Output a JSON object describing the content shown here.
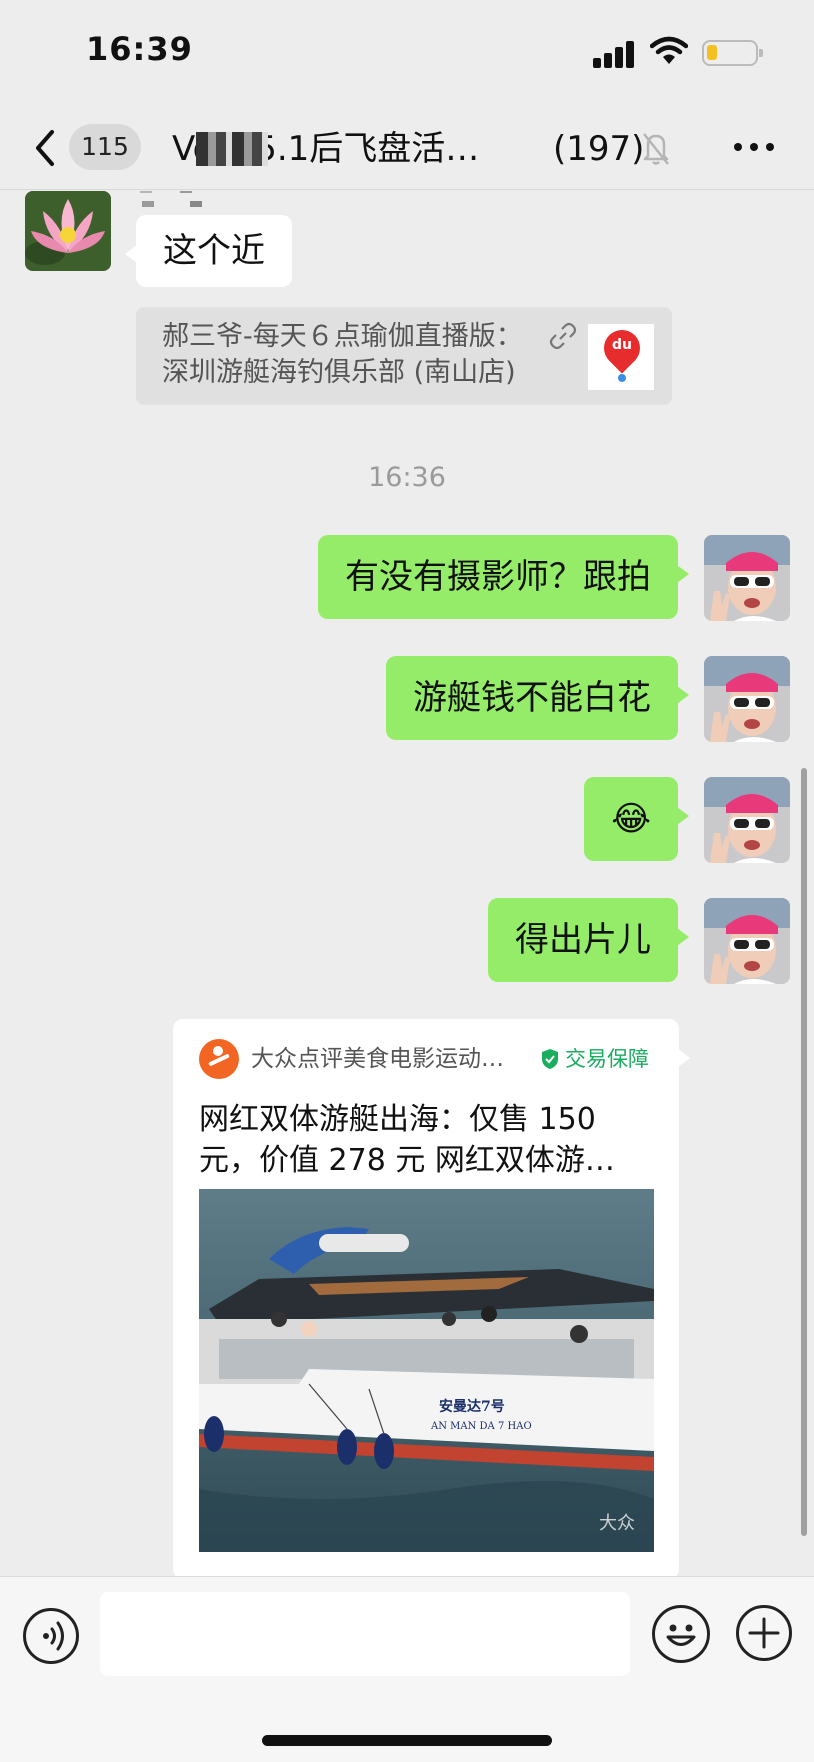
{
  "status_bar": {
    "time": "16:39"
  },
  "nav": {
    "unread_count": "115",
    "title": "Volu  5.1后飞盘活…",
    "member_count": "(197)"
  },
  "messages": {
    "received_text": "这个近",
    "quote_line1": "郝三爷-每天６点瑜伽直播版：",
    "quote_line2": "深圳游艇海钓俱乐部 (南山店)",
    "quote_thumb_label": "du",
    "timestamp": "16:36",
    "sent": [
      {
        "text": "有没有摄影师？跟拍"
      },
      {
        "text": "游艇钱不能白花"
      },
      {
        "text": "😂"
      },
      {
        "text": "得出片儿"
      }
    ]
  },
  "card": {
    "source": "大众点评美食电影运动…",
    "guarantee": "交易保障",
    "title": "网红双体游艇出海：仅售 150 元，价值 278 元 网红双体游…",
    "boat_name": "安曼达7号",
    "boat_name_en": "AN MAN DA 7 HAO",
    "watermark": "大众"
  },
  "input": {
    "placeholder": ""
  },
  "icons": {
    "back": "chevron-left-icon",
    "mute": "bell-slash-icon",
    "more": "ellipsis-icon",
    "link": "link-icon",
    "shield": "shield-check-icon",
    "voice": "voice-icon",
    "emoji": "smiley-icon",
    "plus": "plus-icon"
  },
  "colors": {
    "background": "#ededed",
    "sent_bubble": "#95ec69",
    "received_bubble": "#ffffff",
    "quote_bg": "#e0e0e0",
    "guarantee_green": "#1aad5f",
    "dianping_orange": "#f26522"
  }
}
